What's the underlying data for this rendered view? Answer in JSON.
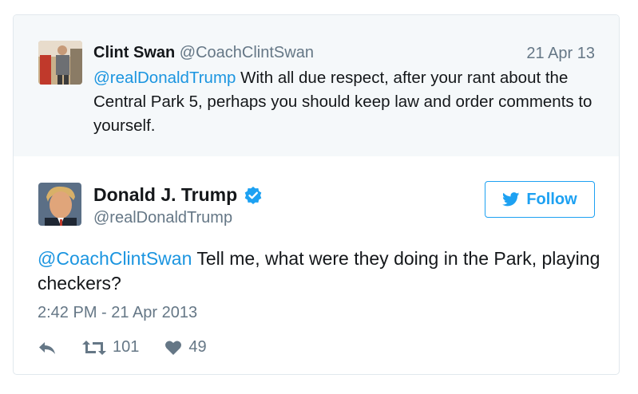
{
  "reply": {
    "name": "Clint Swan",
    "handle": "@CoachClintSwan",
    "date": "21 Apr 13",
    "mention": "@realDonaldTrump",
    "text": " With all due respect, after your rant about the Central Park 5, perhaps you should keep law and order comments to yourself."
  },
  "tweet": {
    "name": "Donald J. Trump",
    "handle": "@realDonaldTrump",
    "mention": "@CoachClintSwan",
    "text": " Tell me, what were they doing in the Park, playing checkers?",
    "timestamp": "2:42 PM - 21 Apr 2013",
    "retweets": "101",
    "likes": "49"
  },
  "follow_label": "Follow",
  "colors": {
    "accent": "#1da1f2",
    "link": "#1b95e0",
    "muted": "#657786",
    "reply_bg": "#f5f8fa"
  },
  "icons": [
    "reply-icon",
    "retweet-icon",
    "heart-icon",
    "twitter-bird-icon",
    "verified-badge-icon"
  ]
}
